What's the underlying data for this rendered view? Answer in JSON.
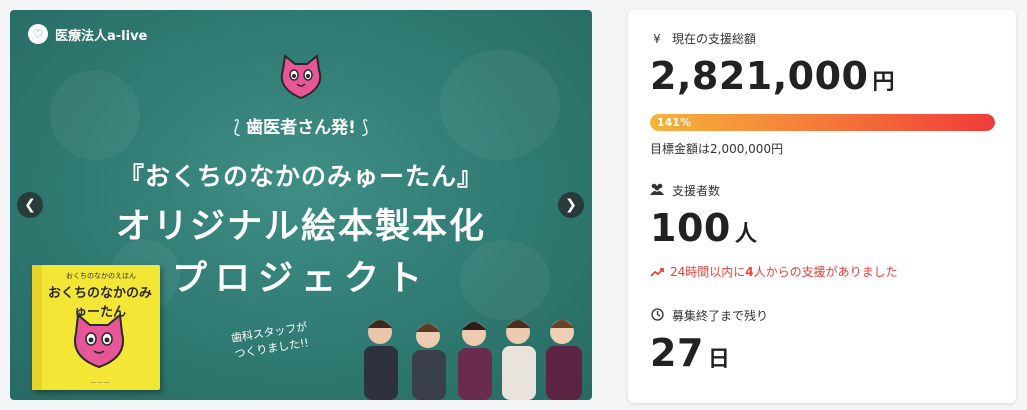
{
  "hero": {
    "org_name": "医療法人a-live",
    "tagline": "歯医者さん発!",
    "title_line1": "『おくちのなかのみゅーたん』",
    "title_line2": "オリジナル絵本製本化",
    "title_line3": "プロジェクト",
    "book_subtitle": "おくちのなかのえほん",
    "book_title": "おくちのなかのみゅーたん",
    "staff_note_line1": "歯科スタッフが",
    "staff_note_line2": "つくりました!!",
    "prev_icon": "chevron-left-icon",
    "next_icon": "chevron-right-icon"
  },
  "funding": {
    "total_label": "現在の支援総額",
    "total_value": "2,821,000",
    "total_unit": "円",
    "progress_percent_text": "141%",
    "progress_fraction": 1.0,
    "goal_text": "目標金額は2,000,000円",
    "supporters_label": "支援者数",
    "supporters_value": "100",
    "supporters_unit": "人",
    "recent_prefix": "24時間以内に",
    "recent_count": "4",
    "recent_suffix": "人からの支援がありました",
    "remaining_label": "募集終了まで残り",
    "remaining_value": "27",
    "remaining_unit": "日"
  },
  "colors": {
    "hero_bg": "#2f7a72",
    "progress_start": "#f6b33b",
    "progress_end": "#ef3b3b",
    "recent_text": "#e8423c"
  },
  "icons": {
    "yen": "yen-icon",
    "supporters": "people-icon",
    "trend": "trend-up-icon",
    "clock": "clock-icon"
  }
}
